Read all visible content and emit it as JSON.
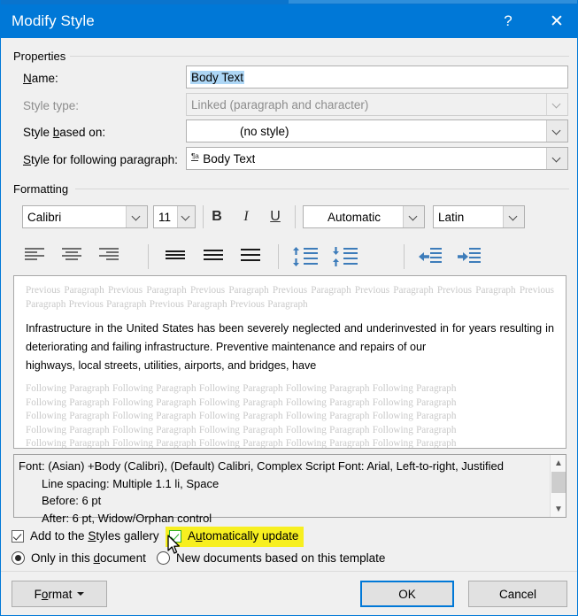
{
  "window": {
    "title": "Modify Style",
    "help_label": "?",
    "close_label": "✕"
  },
  "properties": {
    "group_label": "Properties",
    "name_label": "Name:",
    "name_value": "Body Text",
    "style_type_label": "Style type:",
    "style_type_value": "Linked (paragraph and character)",
    "style_based_on_label": "Style based on:",
    "style_based_on_value": "(no style)",
    "style_following_label": "Style for following paragraph:",
    "style_following_value": "Body Text",
    "style_following_icon": "paragraph-character-style-icon"
  },
  "formatting": {
    "group_label": "Formatting",
    "font_family": "Calibri",
    "font_size": "11",
    "bold_label": "B",
    "italic_label": "I",
    "underline_label": "U",
    "font_color": "Automatic",
    "script": "Latin",
    "toolbar_icons": [
      "align-left-icon",
      "align-center-icon",
      "align-right-icon",
      "justify-low-icon",
      "justify-medium-icon",
      "justify-high-icon",
      "increase-line-spacing-icon",
      "decrease-line-spacing-icon",
      "decrease-indent-icon",
      "increase-indent-icon"
    ]
  },
  "preview": {
    "previous_paragraph": "Previous Paragraph Previous Paragraph Previous Paragraph Previous Paragraph Previous Paragraph Previous Paragraph Previous Paragraph Previous Paragraph Previous Paragraph Previous Paragraph",
    "sample_text": "Infrastructure in the United States has been severely neglected and underinvested in for years resulting in deteriorating and failing infrastructure. Preventive maintenance and repairs of our",
    "sample_text_lastline": "highways, local streets, utilities, airports, and bridges, have",
    "following_paragraph_line": "Following Paragraph Following Paragraph Following Paragraph Following Paragraph Following Paragraph",
    "following_paragraph_count": 6
  },
  "description": {
    "line1": "Font: (Asian) +Body (Calibri), (Default) Calibri, Complex Script Font: Arial, Left-to-right, Justified",
    "line2": "Line spacing:  Multiple 1.1 li, Space",
    "line3": "Before:  6 pt",
    "line4": "After:  6 pt, Widow/Orphan control",
    "scroll_up_icon": "chevron-up-icon",
    "scroll_down_icon": "chevron-down-icon"
  },
  "options": {
    "add_to_gallery_label": "Add to the Styles gallery",
    "add_to_gallery_checked": true,
    "auto_update_label": "Automatically update",
    "auto_update_checked": true,
    "auto_update_highlight_color": "#f7ef20",
    "auto_update_checkbox_color": "#2bb12b",
    "only_this_document_label": "Only in this document",
    "only_this_document_selected": true,
    "new_documents_label": "New documents based on this template",
    "new_documents_selected": false
  },
  "buttons": {
    "format_label": "Format",
    "ok_label": "OK",
    "cancel_label": "Cancel"
  }
}
